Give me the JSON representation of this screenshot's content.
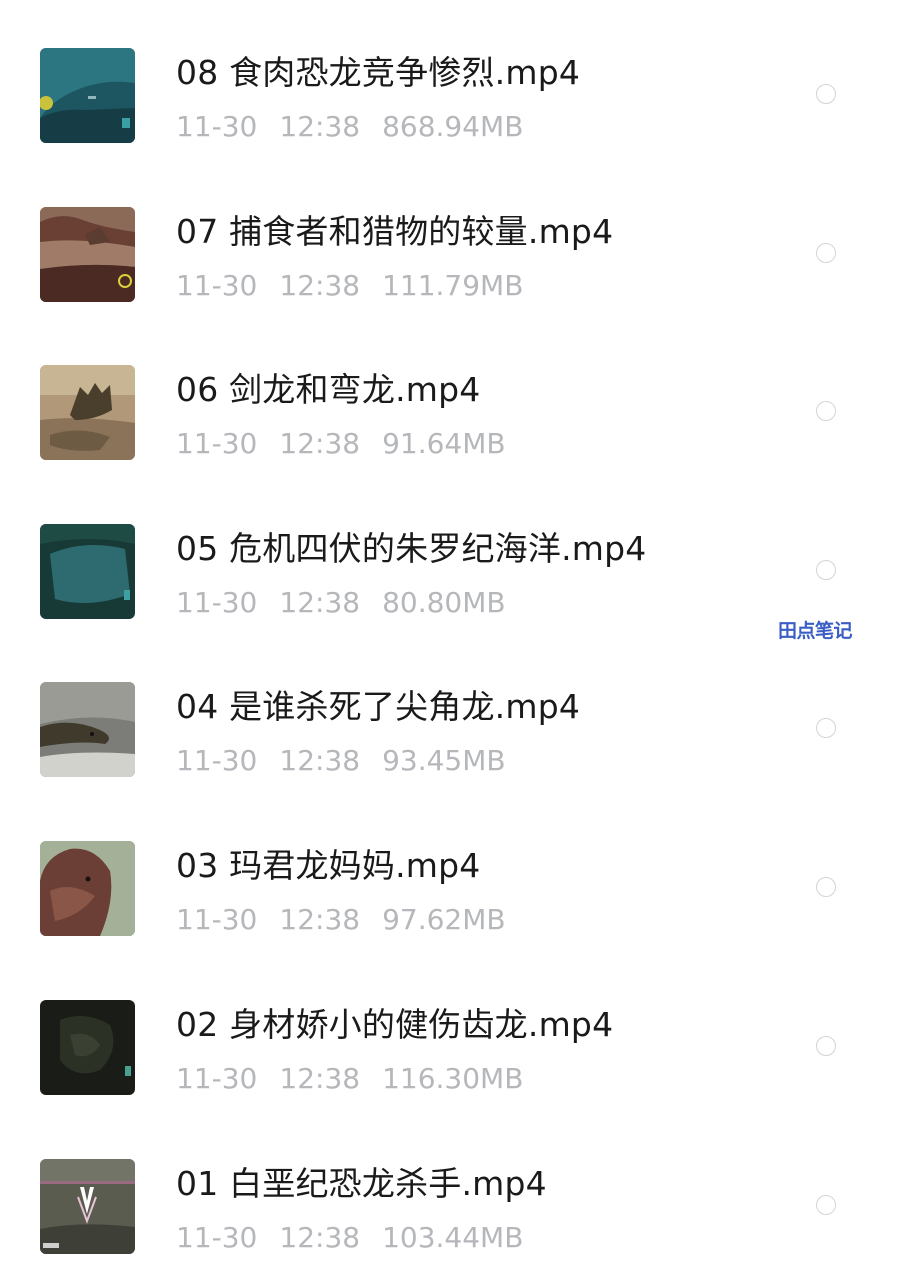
{
  "files": [
    {
      "name": "08 食肉恐龙竞争惨烈.mp4",
      "date": "11-30",
      "time": "12:38",
      "size": "868.94MB",
      "thumbnail": "teal-water-scene"
    },
    {
      "name": "07 捕食者和猎物的较量.mp4",
      "date": "11-30",
      "time": "12:38",
      "size": "111.79MB",
      "thumbnail": "brown-desert-scene"
    },
    {
      "name": "06 剑龙和弯龙.mp4",
      "date": "11-30",
      "time": "12:38",
      "size": "91.64MB",
      "thumbnail": "stegosaurus-scene"
    },
    {
      "name": "05 危机四伏的朱罗纪海洋.mp4",
      "date": "11-30",
      "time": "12:38",
      "size": "80.80MB",
      "thumbnail": "dark-ocean-scene"
    },
    {
      "name": "04 是谁杀死了尖角龙.mp4",
      "date": "11-30",
      "time": "12:38",
      "size": "93.45MB",
      "thumbnail": "dinosaur-head-scene"
    },
    {
      "name": "03 玛君龙妈妈.mp4",
      "date": "11-30",
      "time": "12:38",
      "size": "97.62MB",
      "thumbnail": "dinosaur-closeup-scene"
    },
    {
      "name": "02 身材娇小的健伤齿龙.mp4",
      "date": "11-30",
      "time": "12:38",
      "size": "116.30MB",
      "thumbnail": "dark-forest-scene"
    },
    {
      "name": "01 白垩纪恐龙杀手.mp4",
      "date": "11-30",
      "time": "12:38",
      "size": "103.44MB",
      "thumbnail": "title-card-scene"
    }
  ],
  "watermark": "田点笔记",
  "colors": {
    "title": "#1a1a1a",
    "meta": "#b5b7bb",
    "radio_border": "#d3d4d7",
    "watermark": "#3a5ec4"
  }
}
